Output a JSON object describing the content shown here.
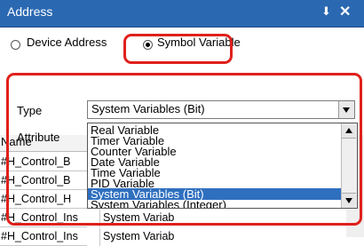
{
  "window": {
    "title": "Address",
    "pin_icon": "pin-icon",
    "close_icon": "close-icon"
  },
  "address_mode": {
    "options": [
      {
        "label": "Device Address",
        "checked": false
      },
      {
        "label": "Symbol Variable",
        "checked": true
      }
    ]
  },
  "form": {
    "type_label": "Type",
    "type_value": "System Variables (Bit)",
    "attribute_label": "Attribute",
    "dropdown_options": [
      {
        "label": "Real Variable",
        "selected": false
      },
      {
        "label": "Timer Variable",
        "selected": false
      },
      {
        "label": "Counter Variable",
        "selected": false
      },
      {
        "label": "Date Variable",
        "selected": false
      },
      {
        "label": "Time Variable",
        "selected": false
      },
      {
        "label": "PID Variable",
        "selected": false
      },
      {
        "label": "System Variables (Bit)",
        "selected": true
      },
      {
        "label": "System Variables (Integer)",
        "selected": false
      }
    ]
  },
  "table": {
    "name_header": "Name",
    "rows": [
      {
        "name": "#H_Control_B",
        "type": ""
      },
      {
        "name": "#H_Control_B",
        "type": ""
      },
      {
        "name": "#H_Control_H",
        "type": ""
      },
      {
        "name": "#H_Control_Ins",
        "type": "System Variab"
      },
      {
        "name": "#H_Control_Ins",
        "type": "System Variab"
      }
    ]
  },
  "colors": {
    "titlebar": "#2a68b2",
    "highlight": "#e0201b",
    "selection": "#2f6fbf"
  }
}
